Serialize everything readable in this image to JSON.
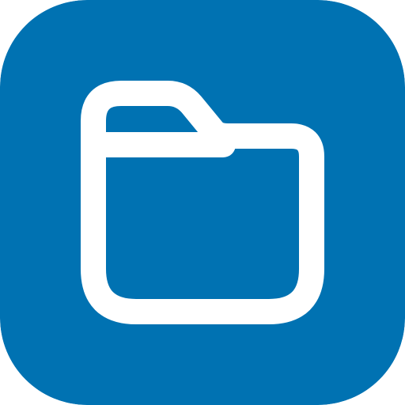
{
  "app_icon": {
    "icon": "folder-icon",
    "background_color": "#0072B2",
    "glyph_color": "#FFFFFF"
  }
}
